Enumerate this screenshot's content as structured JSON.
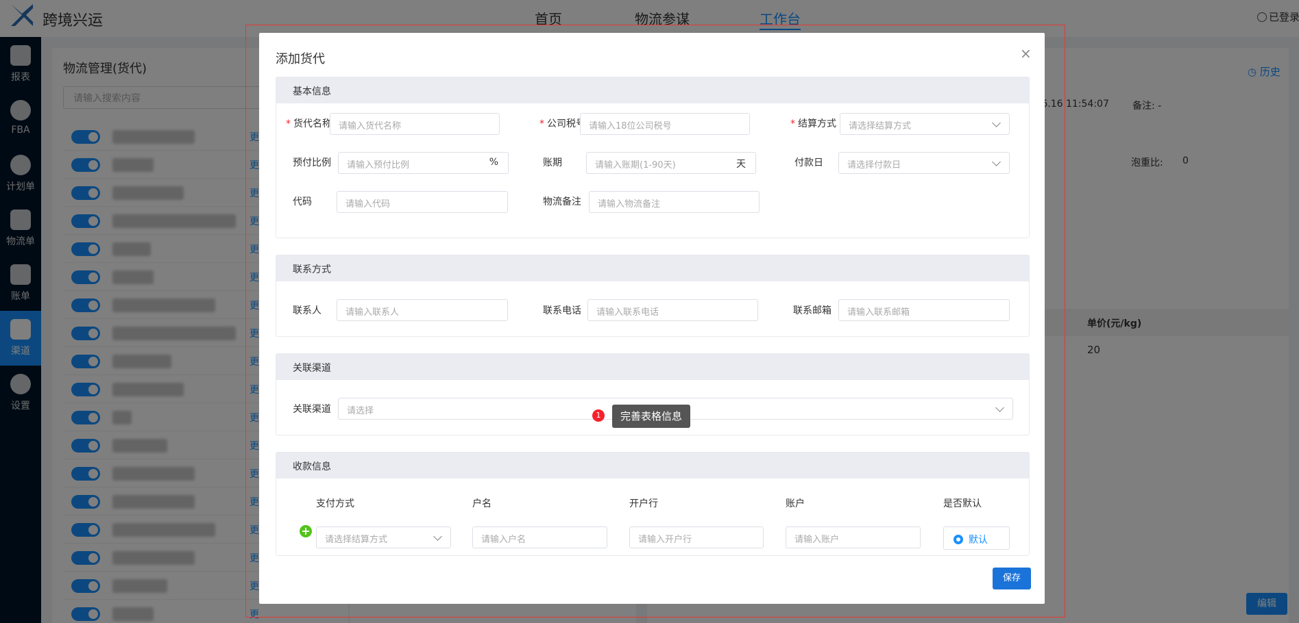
{
  "app": {
    "brand": "跨境兴运",
    "login": "已登录"
  },
  "nav": [
    "首页",
    "物流参谋",
    "工作台"
  ],
  "sidebar": [
    {
      "label": "报表",
      "icon": "bar-chart-icon"
    },
    {
      "label": "FBA",
      "icon": "clock-icon"
    },
    {
      "label": "计划单",
      "icon": "clock-icon"
    },
    {
      "label": "物流单",
      "icon": "truck-icon"
    },
    {
      "label": "账单",
      "icon": "bill-icon"
    },
    {
      "label": "渠道",
      "icon": "channel-icon",
      "active": true
    },
    {
      "label": "设置",
      "icon": "gear-icon"
    }
  ],
  "background": {
    "left_title": "物流管理(货代)",
    "search_placeholder": "请输入搜索内容",
    "more_label": "更",
    "history": "历史",
    "datetime": ".06.16 11:54:07",
    "remark": "备注: -",
    "volume_ratio_label": "泡重比:",
    "volume_ratio_value": "0",
    "unit_price_header": "单价(元/kg)",
    "unit_price_value": "20",
    "edit_button": "编辑"
  },
  "modal": {
    "title": "添加货代",
    "close": "×",
    "sections": {
      "basic": "基本信息",
      "contact": "联系方式",
      "channel": "关联渠道",
      "payment": "收款信息"
    },
    "basic": {
      "forwarder_name": {
        "label": "货代名称",
        "placeholder": "请输入货代名称"
      },
      "tax_no": {
        "label": "公司税号",
        "placeholder": "请输入18位公司税号"
      },
      "settle": {
        "label": "结算方式",
        "placeholder": "请选择结算方式"
      },
      "prepay": {
        "label": "预付比例",
        "placeholder": "请输入预付比例",
        "suffix": "%"
      },
      "term": {
        "label": "账期",
        "placeholder": "请输入账期(1-90天)",
        "suffix": "天"
      },
      "pay_day": {
        "label": "付款日",
        "placeholder": "请选择付款日"
      },
      "code": {
        "label": "代码",
        "placeholder": "请输入代码"
      },
      "note": {
        "label": "物流备注",
        "placeholder": "请输入物流备注"
      }
    },
    "contact": {
      "person": {
        "label": "联系人",
        "placeholder": "请输入联系人"
      },
      "phone": {
        "label": "联系电话",
        "placeholder": "请输入联系电话"
      },
      "email": {
        "label": "联系邮箱",
        "placeholder": "请输入联系邮箱"
      }
    },
    "channel": {
      "label": "关联渠道",
      "placeholder": "请选择"
    },
    "payment": {
      "headers": [
        "支付方式",
        "户名",
        "开户行",
        "账户",
        "是否默认"
      ],
      "method_placeholder": "请选择结算方式",
      "name_placeholder": "请输入户名",
      "bank_placeholder": "请输入开户行",
      "account_placeholder": "请输入账户",
      "default_label": "默认"
    },
    "save": "保存"
  },
  "tooltip": {
    "badge": "1",
    "text": "完善表格信息"
  }
}
